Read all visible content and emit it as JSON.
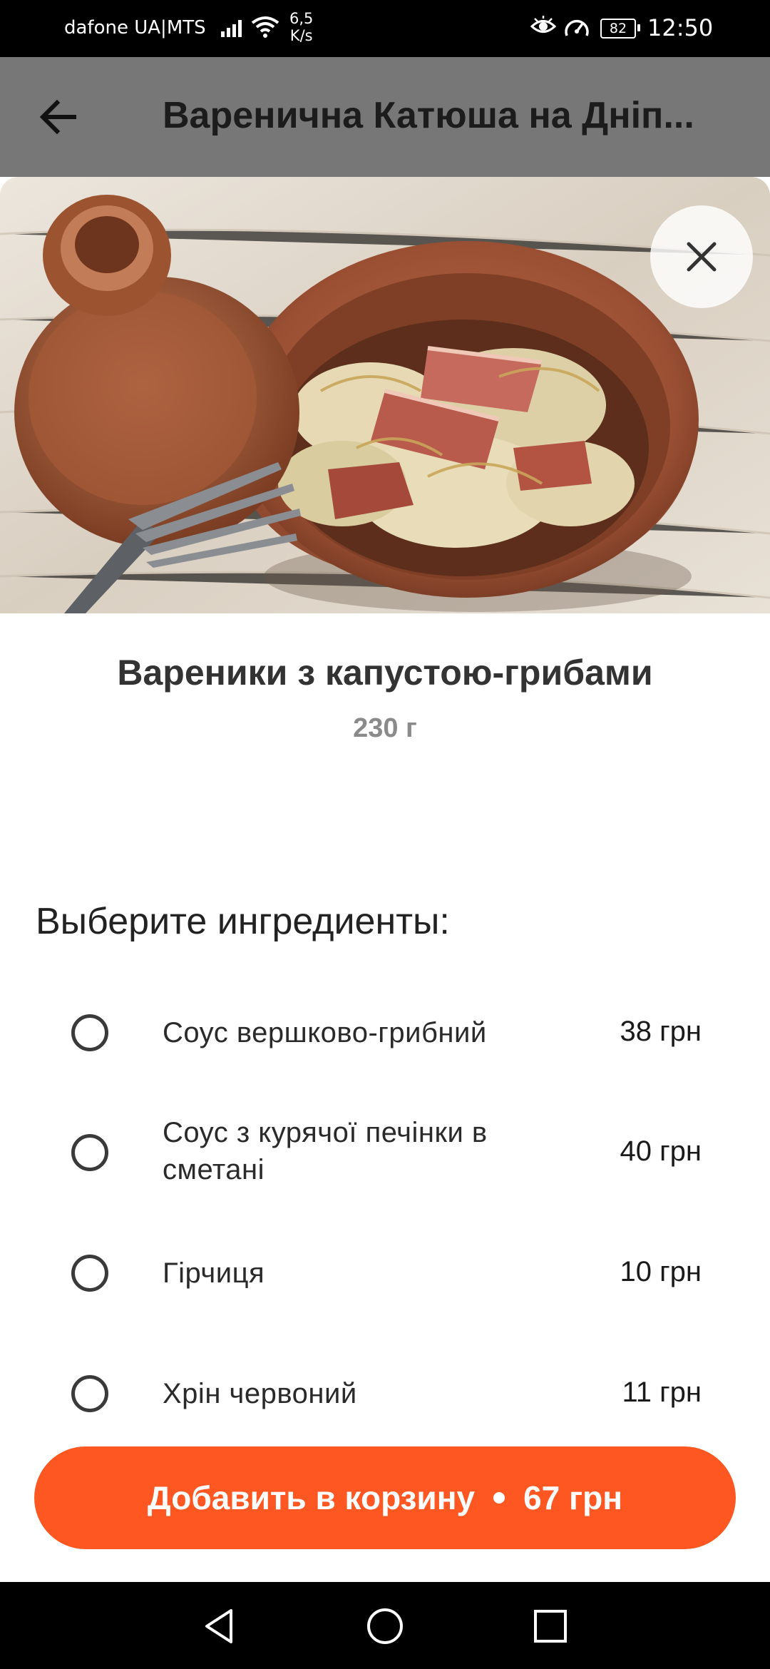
{
  "status_bar": {
    "carrier": "dafone UA|MTS",
    "speed_value": "6,5",
    "speed_unit": "K/s",
    "battery": "82",
    "time": "12:50",
    "icons": [
      "signal-icon",
      "wifi-icon",
      "eye-icon",
      "gauge-icon",
      "battery-icon"
    ]
  },
  "header": {
    "title": "Варенична Катюша на Дніп...",
    "back_icon": "arrow-left-icon"
  },
  "modal": {
    "close_icon": "close-icon",
    "dish": {
      "name": "Вареники з капустою-грибами",
      "weight": "230 г"
    },
    "section_title": "Выберите ингредиенты:",
    "options": [
      {
        "name": "Соус вершково-грибний",
        "price": "38 грн",
        "selected": false
      },
      {
        "name": "Соус з курячої печінки в сметані",
        "price": "40 грн",
        "selected": false
      },
      {
        "name": "Гірчиця",
        "price": "10 грн",
        "selected": false
      },
      {
        "name": "Хрін червоний",
        "price": "11 грн",
        "selected": false
      }
    ],
    "add_button": {
      "label": "Добавить в корзину",
      "price": "67 грн"
    }
  },
  "colors": {
    "accent": "#ff5722",
    "header_dim": "#777777",
    "radio_border": "#3a3a3a"
  },
  "nav_bar": {
    "icons": [
      "nav-back-icon",
      "nav-home-icon",
      "nav-recents-icon"
    ]
  }
}
